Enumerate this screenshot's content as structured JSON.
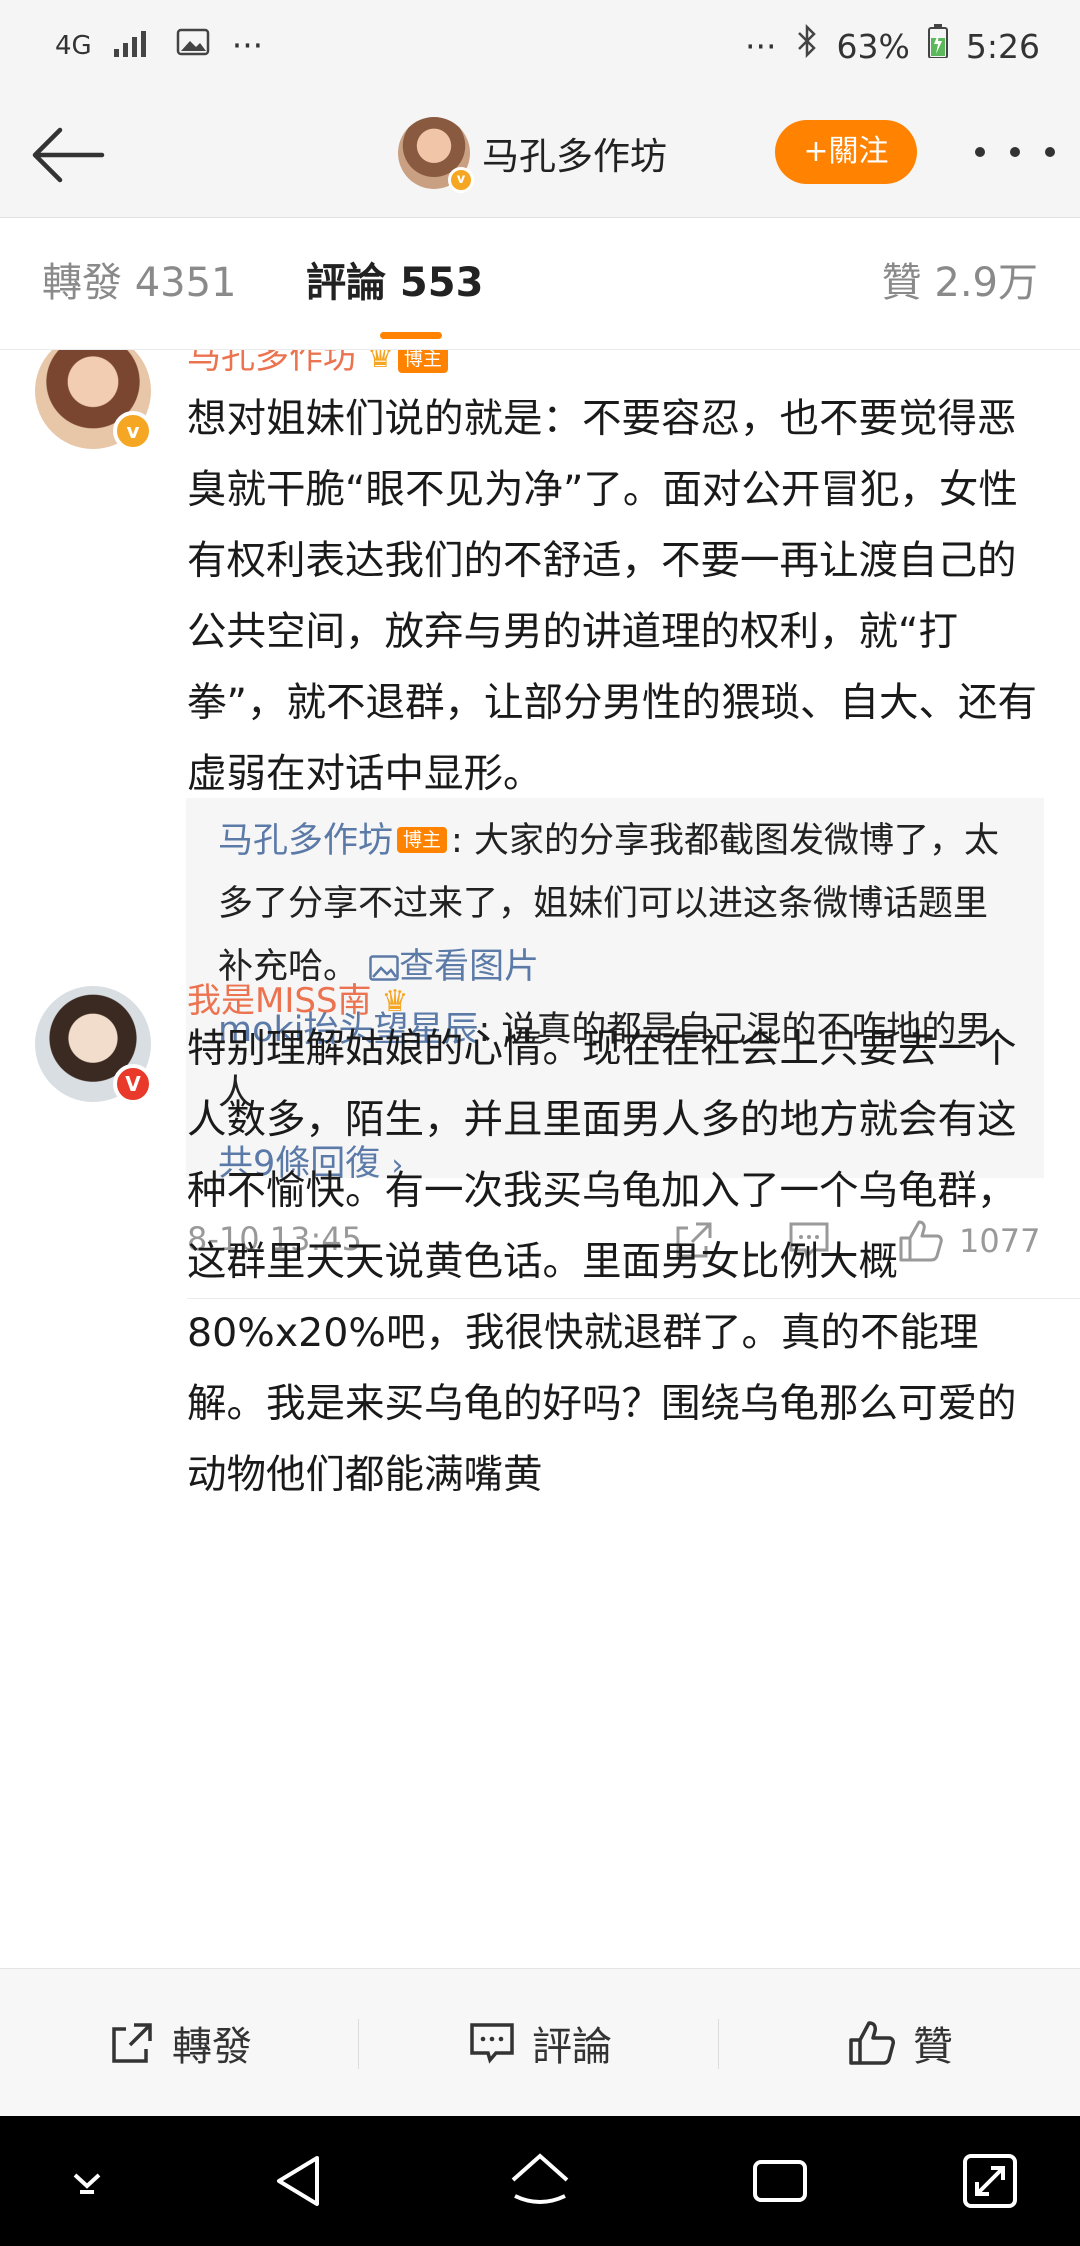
{
  "status_bar": {
    "network": "4G",
    "more_left": "···",
    "more_right": "···",
    "battery": "63%",
    "time": "5:26"
  },
  "header": {
    "name": "马孔多作坊",
    "follow_label": "+關注"
  },
  "tabs": {
    "repost": "轉發 4351",
    "comments": "評論 553",
    "likes": "贊 2.9万"
  },
  "comments": [
    {
      "name": "马孔多作坊",
      "badge": "博主",
      "text": "想对姐妹们说的就是：不要容忍，也不要觉得恶臭就干脆“眼不见为净”了。面对公开冒犯，女性有权利表达我们的不舒适，不要一再让渡自己的公共空间，放弃与男的讲道理的权利，就“打拳”，就不退群，让部分男性的猥琐、自大、还有虚弱在对话中显形。",
      "replies": [
        {
          "user": "马孔多作坊",
          "tag": "博主",
          "text": ": 大家的分享我都截图发微博了，太多了分享不过来了，姐妹们可以进这条微博话题里补充哈。",
          "link": "查看图片"
        },
        {
          "user": "moki抬头望星辰",
          "text": ": 说真的都是自己混的不咋地的男人"
        }
      ],
      "replies_total": "共9條回復",
      "time": "8-10 13:45",
      "likes": "1077"
    },
    {
      "name": "我是MISS南",
      "text": "特别理解姑娘的心情。现在在社会上只要去一个人数多，陌生，并且里面男人多的地方就会有这种不愉快。有一次我买乌龟加入了一个乌龟群，这群里天天说黄色话。里面男女比例大概80%x20%吧，我很快就退群了。真的不能理解。我是来买乌龟的好吗？围绕乌龟那么可爱的动物他们都能满嘴黄"
    }
  ],
  "bottom_bar": {
    "repost": "轉發",
    "comment": "評論",
    "like": "贊"
  },
  "colors": {
    "accent": "#ff8200",
    "username": "#eb7350",
    "link": "#5b7aa8"
  }
}
